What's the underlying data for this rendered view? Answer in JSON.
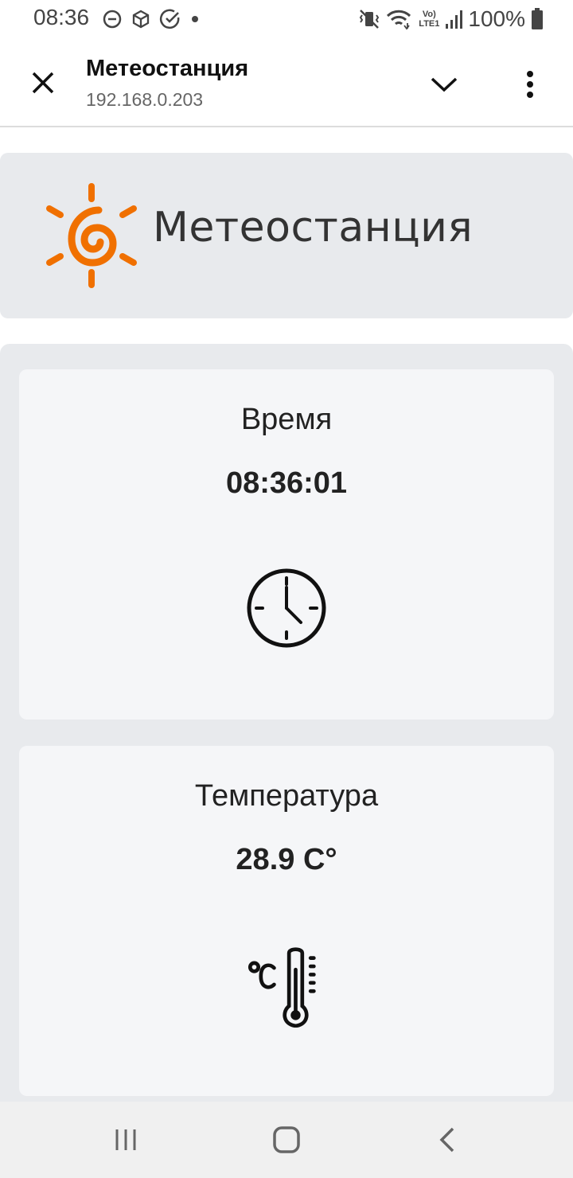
{
  "status_bar": {
    "time": "08:36",
    "battery": "100%",
    "network_label_top": "Vo)",
    "network_label_bottom": "LTE1",
    "icons": [
      "do-not-disturb-icon",
      "package-icon",
      "check-circle-icon",
      "dot-icon",
      "vibrate-icon",
      "wifi-icon",
      "volte-lte-icon",
      "signal-icon",
      "battery-icon"
    ]
  },
  "app_bar": {
    "title": "Метеостанция",
    "subtitle": "192.168.0.203",
    "icons": [
      "close-icon",
      "chevron-down-icon",
      "more-vert-icon"
    ]
  },
  "header": {
    "brand_name": "Метеостанция",
    "logo_icon": "sun-spiral-logo",
    "accent_color": "#f07000"
  },
  "cards": [
    {
      "title": "Время",
      "value": "08:36:01",
      "icon": "clock-icon"
    },
    {
      "title": "Температура",
      "value": "28.9 C°",
      "icon": "thermometer-celsius-icon"
    }
  ],
  "nav_bar": {
    "icons": [
      "recents-icon",
      "home-icon",
      "back-icon"
    ]
  }
}
